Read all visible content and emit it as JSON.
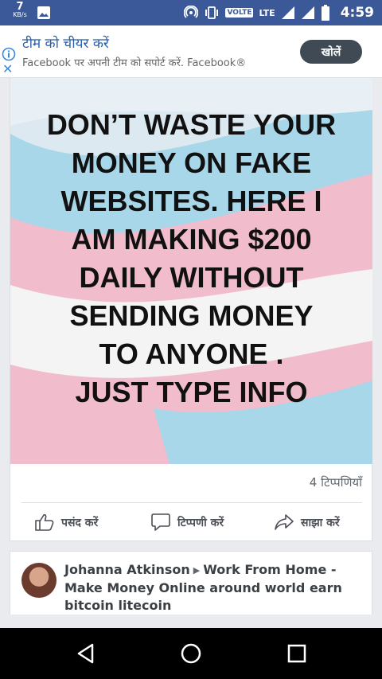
{
  "status_bar": {
    "data_speed": "7",
    "data_unit": "KB/s",
    "volte": "VOLTE",
    "network": "LTE",
    "time": "4:59"
  },
  "ad": {
    "title": "टीम को चीयर करें",
    "subtitle": "Facebook पर अपनी टीम को सपोर्ट करें. Facebook®",
    "button": "खोलें"
  },
  "post": {
    "image_text": [
      "DON’T WASTE YOUR",
      "MONEY ON FAKE",
      "WEBSITES. HERE I",
      "AM MAKING $200",
      "DAILY WITHOUT",
      "SENDING MONEY",
      "TO ANYONE .",
      "JUST TYPE INFO"
    ],
    "comments": "4 टिप्पणियाँ",
    "actions": {
      "like": "पसंद करें",
      "comment": "टिप्पणी करें",
      "share": "साझा करें"
    }
  },
  "next_post": {
    "author": "Johanna Atkinson",
    "group": "Work From Home - Make Money Online around world earn bitcoin litecoin"
  },
  "colors": {
    "brand": "#3b5998",
    "flag_blue": "#a9d7ea",
    "flag_pink": "#f1bccb",
    "flag_white": "#f4f4f4"
  },
  "icons": [
    "gallery-icon",
    "hotspot-icon",
    "vibrate-icon",
    "signal-icon",
    "battery-icon",
    "info-icon",
    "close-icon",
    "like-icon",
    "comment-icon",
    "share-icon",
    "chevron-right-icon",
    "back-icon",
    "home-icon",
    "recents-icon"
  ]
}
